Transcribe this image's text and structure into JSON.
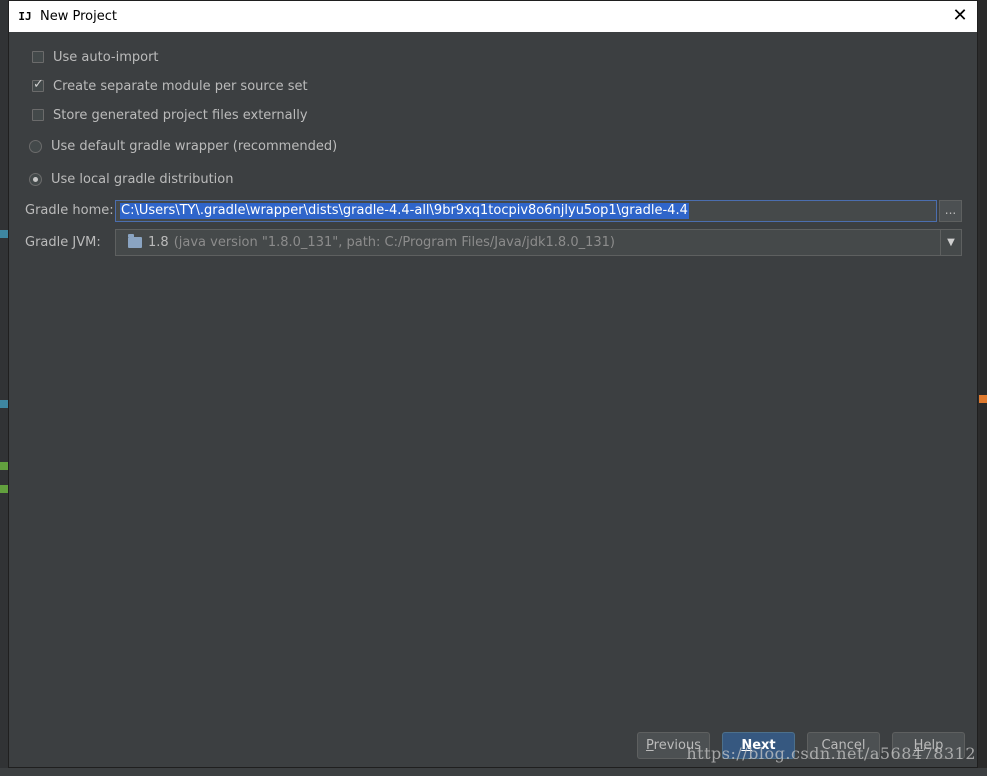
{
  "window": {
    "title": "New Project",
    "app_icon": "intellij-icon"
  },
  "options": {
    "auto_import": {
      "label": "Use auto-import",
      "checked": false
    },
    "separate_module": {
      "label": "Create separate module per source set",
      "checked": true
    },
    "store_externally": {
      "label": "Store generated project files externally",
      "checked": false
    },
    "default_wrapper": {
      "label": "Use default gradle wrapper (recommended)",
      "selected": false
    },
    "local_distribution": {
      "label": "Use local gradle distribution",
      "selected": true
    }
  },
  "gradle_home": {
    "label": "Gradle home:",
    "value": "C:\\Users\\TY\\.gradle\\wrapper\\dists\\gradle-4.4-all\\9br9xq1tocpiv8o6njlyu5op1\\gradle-4.4",
    "browse_label": "..."
  },
  "gradle_jvm": {
    "label": "Gradle JVM:",
    "version": "1.8",
    "detail": "(java version \"1.8.0_131\", path: C:/Program Files/Java/jdk1.8.0_131)"
  },
  "buttons": {
    "previous": {
      "prefix": "",
      "mnemonic": "P",
      "rest": "revious"
    },
    "next": {
      "prefix": "",
      "mnemonic": "N",
      "rest": "ext"
    },
    "cancel": "Cancel",
    "help": {
      "prefix": "",
      "mnemonic": "H",
      "rest": "elp"
    }
  },
  "watermark": "https://blog.csdn.net/a568478312",
  "colors": {
    "dialog_bg": "#3c3f41",
    "selection": "#2f65ca",
    "default_button": "#365880"
  }
}
